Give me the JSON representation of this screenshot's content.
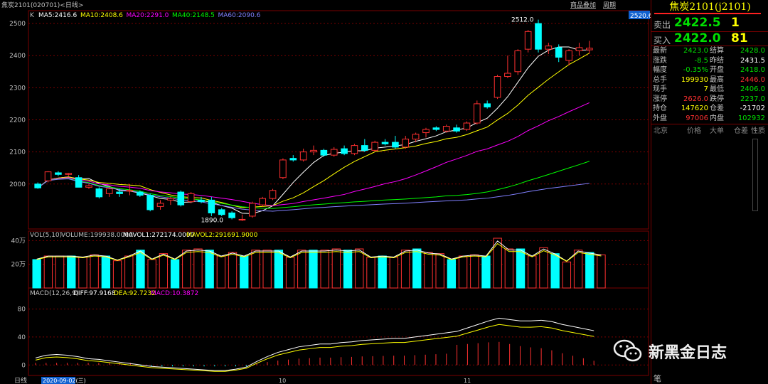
{
  "header": {
    "instrument": "焦炭2101(020701)",
    "period": "<日线>",
    "links": [
      "商品叠加",
      "周期"
    ]
  },
  "ma": {
    "label": "K",
    "items": [
      {
        "name": "MA5",
        "value": "2416.6",
        "color": "#ffffff"
      },
      {
        "name": "MA10",
        "value": "2408.6",
        "color": "#ffff00"
      },
      {
        "name": "MA20",
        "value": "2291.0",
        "color": "#ff00ff"
      },
      {
        "name": "MA40",
        "value": "2148.5",
        "color": "#00ff00"
      },
      {
        "name": "MA60",
        "value": "2090.6",
        "color": "#8080ff"
      }
    ]
  },
  "price_label": "2520.6",
  "vol_info": {
    "label": "VOL(5,10)",
    "volume": "VOLUME:199938.0000",
    "mavol1": "MAVOL1:272174.0000",
    "mavol2": "MAVOL2:291691.9000"
  },
  "macd_info": {
    "label": "MACD(12,26,9)",
    "diff": "DIFF:97.9168",
    "dea": "DEA:92.7232",
    "macd": "MACD:10.3872"
  },
  "bottom": {
    "tab": "日线",
    "date": "2020-09-02(三)",
    "month_labels": [
      "10",
      "11"
    ]
  },
  "annotations": {
    "high": "2512.0",
    "low": "1890.0"
  },
  "panel": {
    "title": "焦炭2101(j2101)",
    "sell": {
      "label": "卖出",
      "price": "2422.5",
      "vol": "1"
    },
    "buy": {
      "label": "买入",
      "price": "2422.0",
      "vol": "81"
    },
    "stats": [
      {
        "k": "最新",
        "v": "2423.0",
        "c": "#00e000"
      },
      {
        "k": "结算",
        "v": "2428.0",
        "c": "#00e000"
      },
      {
        "k": "涨跌",
        "v": "-8.5",
        "c": "#00e000"
      },
      {
        "k": "昨结",
        "v": "2431.5",
        "c": "#ffffff"
      },
      {
        "k": "幅度",
        "v": "-0.35%",
        "c": "#00e000"
      },
      {
        "k": "开盘",
        "v": "2418.0",
        "c": "#00e000"
      },
      {
        "k": "总手",
        "v": "199930",
        "c": "#ffff00"
      },
      {
        "k": "最高",
        "v": "2446.0",
        "c": "#ff3030"
      },
      {
        "k": "现手",
        "v": "7",
        "c": "#ffff00"
      },
      {
        "k": "最低",
        "v": "2406.0",
        "c": "#00e000"
      },
      {
        "k": "涨停",
        "v": "2626.0",
        "c": "#ff3030"
      },
      {
        "k": "跌停",
        "v": "2237.0",
        "c": "#00e000"
      },
      {
        "k": "持仓",
        "v": "147620",
        "c": "#ffff00"
      },
      {
        "k": "仓差",
        "v": "-21702",
        "c": "#ffffff"
      },
      {
        "k": "外盘",
        "v": "97006",
        "c": "#ff3030"
      },
      {
        "k": "内盘",
        "v": "102932",
        "c": "#00e000"
      }
    ],
    "tabs": [
      "北京",
      "价格",
      "大单",
      "仓差",
      "性质"
    ],
    "bottom_char": "笔"
  },
  "watermark": "新黑金日志",
  "chart_data": {
    "type": "candlestick",
    "price_axis": {
      "ticks": [
        2000,
        2100,
        2200,
        2300,
        2400,
        2500
      ]
    },
    "vol_axis": {
      "ticks": [
        "20万",
        "40万"
      ]
    },
    "macd_axis": {
      "ticks": [
        0,
        40,
        80
      ]
    },
    "candles": [
      {
        "o": 2000,
        "h": 2005,
        "l": 1985,
        "c": 1988
      },
      {
        "o": 2010,
        "h": 2040,
        "l": 2005,
        "c": 2038
      },
      {
        "o": 2035,
        "h": 2040,
        "l": 2025,
        "c": 2030
      },
      {
        "o": 2030,
        "h": 2035,
        "l": 2025,
        "c": 2033
      },
      {
        "o": 2020,
        "h": 2028,
        "l": 2000,
        "c": 1990
      },
      {
        "o": 1990,
        "h": 2000,
        "l": 1985,
        "c": 1995
      },
      {
        "o": 1985,
        "h": 1990,
        "l": 1955,
        "c": 1960
      },
      {
        "o": 1970,
        "h": 1990,
        "l": 1960,
        "c": 1985
      },
      {
        "o": 1975,
        "h": 1985,
        "l": 1960,
        "c": 1970
      },
      {
        "o": 1980,
        "h": 2000,
        "l": 1965,
        "c": 1980
      },
      {
        "o": 1975,
        "h": 1980,
        "l": 1960,
        "c": 1965
      },
      {
        "o": 1965,
        "h": 1970,
        "l": 1915,
        "c": 1920
      },
      {
        "o": 1930,
        "h": 1950,
        "l": 1920,
        "c": 1940
      },
      {
        "o": 1950,
        "h": 1960,
        "l": 1935,
        "c": 1955
      },
      {
        "o": 1975,
        "h": 1980,
        "l": 1930,
        "c": 1935
      },
      {
        "o": 1945,
        "h": 1975,
        "l": 1940,
        "c": 1970
      },
      {
        "o": 1950,
        "h": 1960,
        "l": 1940,
        "c": 1945
      },
      {
        "o": 1950,
        "h": 1960,
        "l": 1900,
        "c": 1910
      },
      {
        "o": 1920,
        "h": 1925,
        "l": 1900,
        "c": 1905
      },
      {
        "o": 1910,
        "h": 1915,
        "l": 1890,
        "c": 1895
      },
      {
        "o": 1890,
        "h": 1905,
        "l": 1885,
        "c": 1890
      },
      {
        "o": 1900,
        "h": 1945,
        "l": 1895,
        "c": 1940
      },
      {
        "o": 1935,
        "h": 1960,
        "l": 1930,
        "c": 1955
      },
      {
        "o": 1955,
        "h": 1985,
        "l": 1950,
        "c": 1980
      },
      {
        "o": 2020,
        "h": 2080,
        "l": 2015,
        "c": 2075
      },
      {
        "o": 2080,
        "h": 2090,
        "l": 2070,
        "c": 2075
      },
      {
        "o": 2075,
        "h": 2110,
        "l": 2070,
        "c": 2100
      },
      {
        "o": 2100,
        "h": 2120,
        "l": 2090,
        "c": 2105
      },
      {
        "o": 2105,
        "h": 2110,
        "l": 2085,
        "c": 2090
      },
      {
        "o": 2090,
        "h": 2115,
        "l": 2085,
        "c": 2108
      },
      {
        "o": 2110,
        "h": 2120,
        "l": 2090,
        "c": 2095
      },
      {
        "o": 2095,
        "h": 2125,
        "l": 2090,
        "c": 2120
      },
      {
        "o": 2120,
        "h": 2140,
        "l": 2100,
        "c": 2105
      },
      {
        "o": 2105,
        "h": 2135,
        "l": 2100,
        "c": 2130
      },
      {
        "o": 2130,
        "h": 2140,
        "l": 2120,
        "c": 2125
      },
      {
        "o": 2130,
        "h": 2150,
        "l": 2110,
        "c": 2115
      },
      {
        "o": 2115,
        "h": 2150,
        "l": 2110,
        "c": 2140
      },
      {
        "o": 2140,
        "h": 2160,
        "l": 2130,
        "c": 2155
      },
      {
        "o": 2160,
        "h": 2175,
        "l": 2145,
        "c": 2170
      },
      {
        "o": 2175,
        "h": 2180,
        "l": 2165,
        "c": 2170
      },
      {
        "o": 2165,
        "h": 2185,
        "l": 2160,
        "c": 2180
      },
      {
        "o": 2175,
        "h": 2185,
        "l": 2160,
        "c": 2165
      },
      {
        "o": 2170,
        "h": 2195,
        "l": 2165,
        "c": 2190
      },
      {
        "o": 2190,
        "h": 2260,
        "l": 2185,
        "c": 2250
      },
      {
        "o": 2250,
        "h": 2260,
        "l": 2235,
        "c": 2240
      },
      {
        "o": 2270,
        "h": 2340,
        "l": 2265,
        "c": 2335
      },
      {
        "o": 2335,
        "h": 2400,
        "l": 2330,
        "c": 2345
      },
      {
        "o": 2350,
        "h": 2420,
        "l": 2340,
        "c": 2415
      },
      {
        "o": 2420,
        "h": 2480,
        "l": 2410,
        "c": 2475
      },
      {
        "o": 2500,
        "h": 2512,
        "l": 2410,
        "c": 2420
      },
      {
        "o": 2420,
        "h": 2440,
        "l": 2405,
        "c": 2430
      },
      {
        "o": 2425,
        "h": 2435,
        "l": 2380,
        "c": 2395
      },
      {
        "o": 2385,
        "h": 2420,
        "l": 2370,
        "c": 2415
      },
      {
        "o": 2415,
        "h": 2440,
        "l": 2400,
        "c": 2425
      },
      {
        "o": 2418,
        "h": 2446,
        "l": 2406,
        "c": 2423
      }
    ],
    "volumes": [
      24,
      27,
      27,
      27,
      26,
      28,
      27,
      23,
      27,
      32,
      24,
      29,
      24,
      32,
      33,
      32,
      27,
      30,
      27,
      32,
      32,
      32,
      26,
      32,
      32,
      32,
      33,
      32,
      33,
      26,
      27,
      26,
      32,
      33,
      30,
      29,
      24,
      27,
      28,
      27,
      42,
      33,
      33,
      27,
      34,
      29,
      22,
      32,
      30,
      28
    ],
    "macd": [
      10,
      14,
      15,
      14,
      12,
      9,
      8,
      6,
      4,
      2,
      0,
      -2,
      -3,
      -4,
      -5,
      -6,
      -7,
      -8,
      -8,
      -6,
      -3,
      5,
      12,
      18,
      22,
      26,
      28,
      30,
      30,
      32,
      33,
      35,
      36,
      37,
      38,
      38,
      40,
      42,
      44,
      46,
      48,
      50,
      52,
      54,
      55,
      50,
      45,
      42,
      40,
      35,
      28,
      22,
      16,
      10
    ]
  }
}
